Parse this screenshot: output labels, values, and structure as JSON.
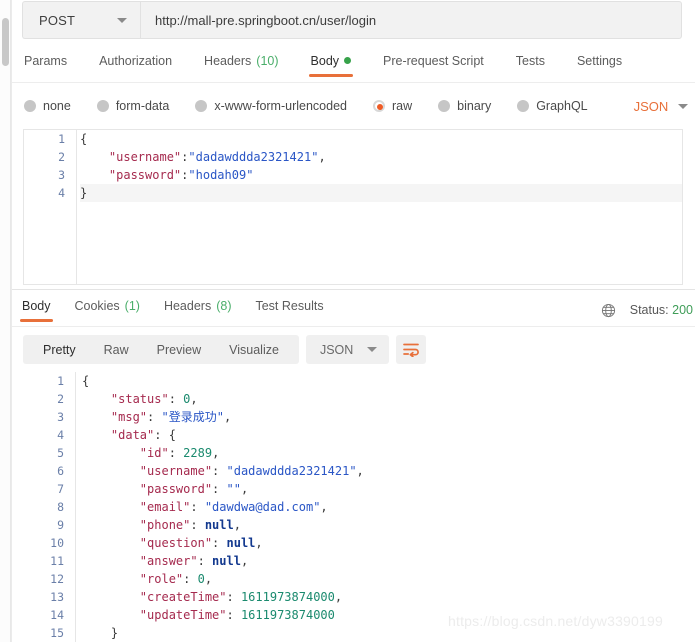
{
  "request": {
    "method": "POST",
    "url": "http://mall-pre.springboot.cn/user/login",
    "tabs": [
      {
        "label": "Params",
        "count": "",
        "active": false,
        "dot": false
      },
      {
        "label": "Authorization",
        "count": "",
        "active": false,
        "dot": false
      },
      {
        "label": "Headers",
        "count": "(10)",
        "active": false,
        "dot": false
      },
      {
        "label": "Body",
        "count": "",
        "active": true,
        "dot": true
      },
      {
        "label": "Pre-request Script",
        "count": "",
        "active": false,
        "dot": false
      },
      {
        "label": "Tests",
        "count": "",
        "active": false,
        "dot": false
      },
      {
        "label": "Settings",
        "count": "",
        "active": false,
        "dot": false
      }
    ],
    "body_types": [
      {
        "label": "none",
        "selected": false
      },
      {
        "label": "form-data",
        "selected": false
      },
      {
        "label": "x-www-form-urlencoded",
        "selected": false
      },
      {
        "label": "raw",
        "selected": true
      },
      {
        "label": "binary",
        "selected": false
      },
      {
        "label": "GraphQL",
        "selected": false
      }
    ],
    "format_label": "JSON",
    "editor": {
      "line_numbers": [
        "1",
        "2",
        "3",
        "4"
      ],
      "lines": [
        [
          {
            "t": "{",
            "c": "p"
          }
        ],
        [
          {
            "t": "    ",
            "c": "p"
          },
          {
            "t": "\"username\"",
            "c": "k"
          },
          {
            "t": ":",
            "c": "p"
          },
          {
            "t": "\"dadawddda2321421\"",
            "c": "s"
          },
          {
            "t": ",",
            "c": "p"
          }
        ],
        [
          {
            "t": "    ",
            "c": "p"
          },
          {
            "t": "\"password\"",
            "c": "k"
          },
          {
            "t": ":",
            "c": "p"
          },
          {
            "t": "\"hodah09\"",
            "c": "s"
          }
        ],
        [
          {
            "t": "}",
            "c": "p"
          }
        ]
      ],
      "highlight_line": 4
    }
  },
  "response": {
    "tabs": [
      {
        "label": "Body",
        "count": "",
        "active": true
      },
      {
        "label": "Cookies",
        "count": "(1)",
        "active": false
      },
      {
        "label": "Headers",
        "count": "(8)",
        "active": false
      },
      {
        "label": "Test Results",
        "count": "",
        "active": false
      }
    ],
    "status_label": "Status:",
    "status_code": "200",
    "view_modes": [
      {
        "label": "Pretty",
        "active": true
      },
      {
        "label": "Raw",
        "active": false
      },
      {
        "label": "Preview",
        "active": false
      },
      {
        "label": "Visualize",
        "active": false
      }
    ],
    "format_label": "JSON",
    "body": {
      "line_numbers": [
        "1",
        "2",
        "3",
        "4",
        "5",
        "6",
        "7",
        "8",
        "9",
        "10",
        "11",
        "12",
        "13",
        "14",
        "15"
      ],
      "lines": [
        [
          {
            "t": "{",
            "c": "p"
          }
        ],
        [
          {
            "t": "    ",
            "c": "p"
          },
          {
            "t": "\"status\"",
            "c": "k"
          },
          {
            "t": ": ",
            "c": "p"
          },
          {
            "t": "0",
            "c": "n"
          },
          {
            "t": ",",
            "c": "p"
          }
        ],
        [
          {
            "t": "    ",
            "c": "p"
          },
          {
            "t": "\"msg\"",
            "c": "k"
          },
          {
            "t": ": ",
            "c": "p"
          },
          {
            "t": "\"登录成功\"",
            "c": "s"
          },
          {
            "t": ",",
            "c": "p"
          }
        ],
        [
          {
            "t": "    ",
            "c": "p"
          },
          {
            "t": "\"data\"",
            "c": "k"
          },
          {
            "t": ": {",
            "c": "p"
          }
        ],
        [
          {
            "t": "        ",
            "c": "p"
          },
          {
            "t": "\"id\"",
            "c": "k"
          },
          {
            "t": ": ",
            "c": "p"
          },
          {
            "t": "2289",
            "c": "n"
          },
          {
            "t": ",",
            "c": "p"
          }
        ],
        [
          {
            "t": "        ",
            "c": "p"
          },
          {
            "t": "\"username\"",
            "c": "k"
          },
          {
            "t": ": ",
            "c": "p"
          },
          {
            "t": "\"dadawddda2321421\"",
            "c": "s"
          },
          {
            "t": ",",
            "c": "p"
          }
        ],
        [
          {
            "t": "        ",
            "c": "p"
          },
          {
            "t": "\"password\"",
            "c": "k"
          },
          {
            "t": ": ",
            "c": "p"
          },
          {
            "t": "\"\"",
            "c": "s"
          },
          {
            "t": ",",
            "c": "p"
          }
        ],
        [
          {
            "t": "        ",
            "c": "p"
          },
          {
            "t": "\"email\"",
            "c": "k"
          },
          {
            "t": ": ",
            "c": "p"
          },
          {
            "t": "\"dawdwa@dad.com\"",
            "c": "s"
          },
          {
            "t": ",",
            "c": "p"
          }
        ],
        [
          {
            "t": "        ",
            "c": "p"
          },
          {
            "t": "\"phone\"",
            "c": "k"
          },
          {
            "t": ": ",
            "c": "p"
          },
          {
            "t": "null",
            "c": "nu"
          },
          {
            "t": ",",
            "c": "p"
          }
        ],
        [
          {
            "t": "        ",
            "c": "p"
          },
          {
            "t": "\"question\"",
            "c": "k"
          },
          {
            "t": ": ",
            "c": "p"
          },
          {
            "t": "null",
            "c": "nu"
          },
          {
            "t": ",",
            "c": "p"
          }
        ],
        [
          {
            "t": "        ",
            "c": "p"
          },
          {
            "t": "\"answer\"",
            "c": "k"
          },
          {
            "t": ": ",
            "c": "p"
          },
          {
            "t": "null",
            "c": "nu"
          },
          {
            "t": ",",
            "c": "p"
          }
        ],
        [
          {
            "t": "        ",
            "c": "p"
          },
          {
            "t": "\"role\"",
            "c": "k"
          },
          {
            "t": ": ",
            "c": "p"
          },
          {
            "t": "0",
            "c": "n"
          },
          {
            "t": ",",
            "c": "p"
          }
        ],
        [
          {
            "t": "        ",
            "c": "p"
          },
          {
            "t": "\"createTime\"",
            "c": "k"
          },
          {
            "t": ": ",
            "c": "p"
          },
          {
            "t": "1611973874000",
            "c": "n"
          },
          {
            "t": ",",
            "c": "p"
          }
        ],
        [
          {
            "t": "        ",
            "c": "p"
          },
          {
            "t": "\"updateTime\"",
            "c": "k"
          },
          {
            "t": ": ",
            "c": "p"
          },
          {
            "t": "1611973874000",
            "c": "n"
          }
        ],
        [
          {
            "t": "    }",
            "c": "p"
          }
        ]
      ]
    }
  },
  "watermark": "https://blog.csdn.net/dyw3390199",
  "colors": {
    "accent": "#e8703a",
    "raw_dot": "#ef5b25",
    "status_green": "#3f9d58",
    "count_green": "#4aae6a"
  }
}
